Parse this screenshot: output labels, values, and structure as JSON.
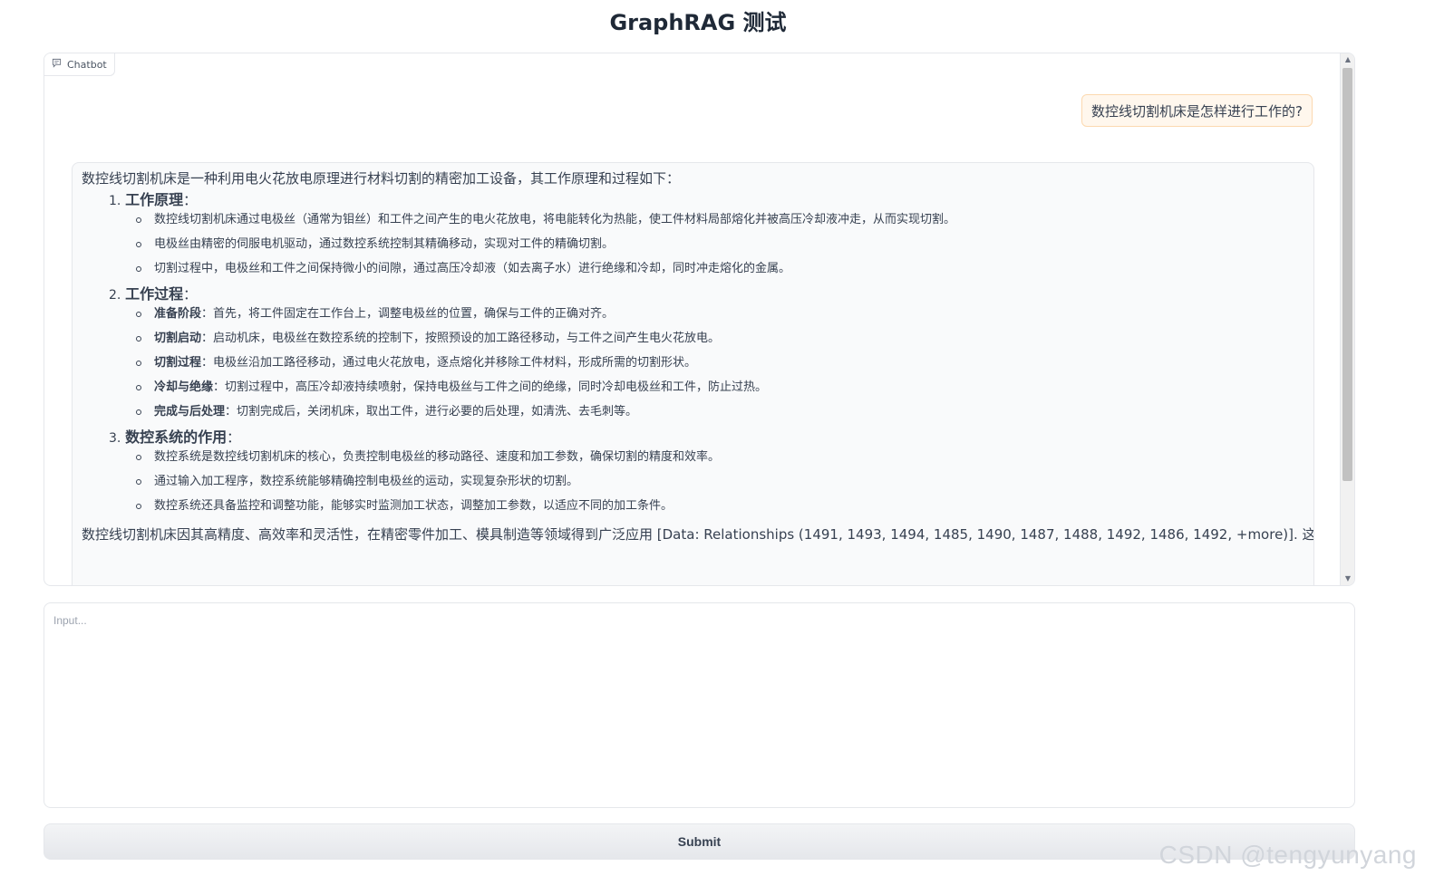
{
  "page": {
    "title": "GraphRAG 测试"
  },
  "chatbot": {
    "label": "Chatbot",
    "user_message": "数控线切割机床是怎样进行工作的?",
    "bot": {
      "intro": "数控线切割机床是一种利用电火花放电原理进行材料切割的精密加工设备，其工作原理和过程如下：",
      "sections": [
        {
          "num": "1.",
          "title": "工作原理",
          "colon": "：",
          "items": [
            {
              "bold": "",
              "text": "数控线切割机床通过电极丝（通常为钼丝）和工件之间产生的电火花放电，将电能转化为热能，使工件材料局部熔化并被高压冷却液冲走，从而实现切割。"
            },
            {
              "bold": "",
              "text": "电极丝由精密的伺服电机驱动，通过数控系统控制其精确移动，实现对工件的精确切割。"
            },
            {
              "bold": "",
              "text": "切割过程中，电极丝和工件之间保持微小的间隙，通过高压冷却液（如去离子水）进行绝缘和冷却，同时冲走熔化的金属。"
            }
          ]
        },
        {
          "num": "2.",
          "title": "工作过程",
          "colon": "：",
          "items": [
            {
              "bold": "准备阶段",
              "text": "：首先，将工件固定在工作台上，调整电极丝的位置，确保与工件的正确对齐。"
            },
            {
              "bold": "切割启动",
              "text": "：启动机床，电极丝在数控系统的控制下，按照预设的加工路径移动，与工件之间产生电火花放电。"
            },
            {
              "bold": "切割过程",
              "text": "：电极丝沿加工路径移动，通过电火花放电，逐点熔化并移除工件材料，形成所需的切割形状。"
            },
            {
              "bold": "冷却与绝缘",
              "text": "：切割过程中，高压冷却液持续喷射，保持电极丝与工件之间的绝缘，同时冷却电极丝和工件，防止过热。"
            },
            {
              "bold": "完成与后处理",
              "text": "：切割完成后，关闭机床，取出工件，进行必要的后处理，如清洗、去毛刺等。"
            }
          ]
        },
        {
          "num": "3.",
          "title": "数控系统的作用",
          "colon": "：",
          "items": [
            {
              "bold": "",
              "text": "数控系统是数控线切割机床的核心，负责控制电极丝的移动路径、速度和加工参数，确保切割的精度和效率。"
            },
            {
              "bold": "",
              "text": "通过输入加工程序，数控系统能够精确控制电极丝的运动，实现复杂形状的切割。"
            },
            {
              "bold": "",
              "text": "数控系统还具备监控和调整功能，能够实时监测加工状态，调整加工参数，以适应不同的加工条件。"
            }
          ]
        }
      ],
      "tail": "数控线切割机床因其高精度、高效率和灵活性，在精密零件加工、模具制造等领域得到广泛应用 [Data: Relationships (1491, 1493, 1494, 1485, 1490, 1487, 1488, 1492, 1486, 1492, +more)]. 这些数据记录"
    },
    "scroll": {
      "up_arrow": "▲",
      "down_arrow": "▼"
    }
  },
  "input": {
    "placeholder": "Input...",
    "value": ""
  },
  "submit": {
    "label": "Submit"
  },
  "watermark": "CSDN @tengyunyang"
}
